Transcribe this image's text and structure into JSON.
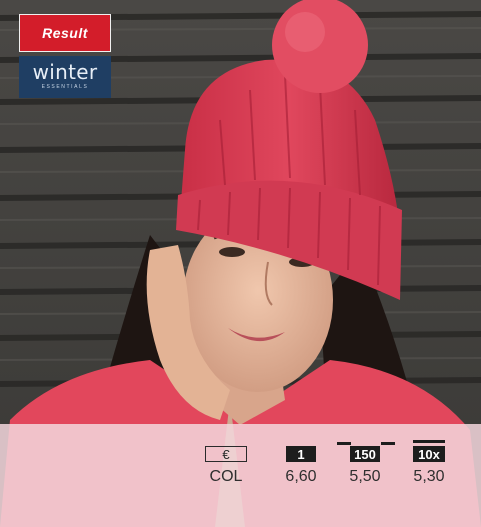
{
  "brand": {
    "primary_logo": "Result",
    "secondary_logo": "winter",
    "secondary_tagline": "ESSENTIALS",
    "primary_color": "#d31d2a",
    "secondary_color": "#1f3e63"
  },
  "photo": {
    "icon": "model-wearing-pink-beanie-photo"
  },
  "price_table": {
    "headers": [
      "€",
      "1",
      "150",
      "10x"
    ],
    "values": [
      "COL",
      "6,60",
      "5,50",
      "5,30"
    ]
  },
  "colors": {
    "hat": "#d8384f",
    "jacket": "#e2475c",
    "band": "#f3d6dc"
  }
}
